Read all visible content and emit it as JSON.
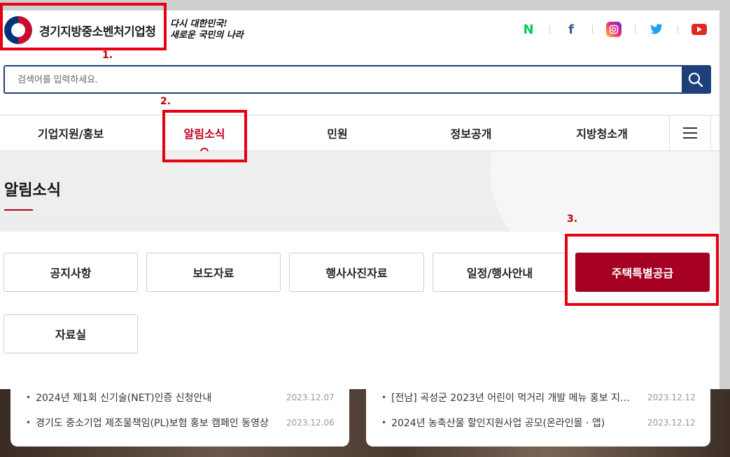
{
  "header": {
    "logo_text": "경기지방중소벤처기업청",
    "slogan_line1": "다시 대한민국!",
    "slogan_line2": "새로운 국민의 나라",
    "sns": [
      "N",
      "f",
      "◎",
      "🐦",
      "▶"
    ]
  },
  "search": {
    "placeholder": "검색어를 입력하세요."
  },
  "gnb": {
    "items": [
      "기업지원/홍보",
      "알림소식",
      "민원",
      "정보공개",
      "지방청소개"
    ],
    "active": "알림소식"
  },
  "sub": {
    "title": "알림소식"
  },
  "tabs": [
    "공지사항",
    "보도자료",
    "행사사진자료",
    "일정/행사안내",
    "주택특별공급",
    "자료실"
  ],
  "annotations": [
    "1.",
    "2.",
    "3."
  ],
  "news_left": [
    {
      "title": "2024년 제1회 신기술(NET)인증 신청안내",
      "date": "2023.12.07"
    },
    {
      "title": "경기도 중소기업 제조물책임(PL)보험 홍보 캠페인 동영상",
      "date": "2023.12.06"
    }
  ],
  "news_right": [
    {
      "title": "[전남] 곡성군 2023년 어린이 먹거리 개발 메뉴 홍보 지…",
      "date": "2023.12.12"
    },
    {
      "title": "2024년 농축산물 할인지원사업 공모(온라인몰 · 앱)",
      "date": "2023.12.12"
    }
  ],
  "colors": {
    "brand_navy": "#1d3f7a",
    "accent_red": "#a50021",
    "annotation_red": "#e60012"
  }
}
